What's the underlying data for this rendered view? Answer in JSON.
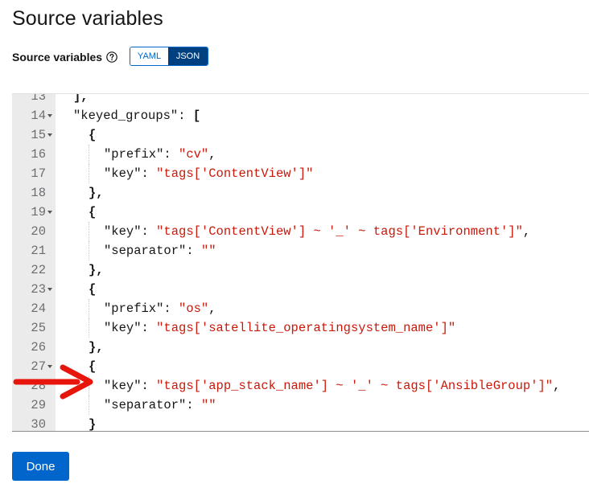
{
  "page": {
    "title": "Source variables"
  },
  "field": {
    "label": "Source variables",
    "help_icon": "question-circle-icon"
  },
  "toggle": {
    "yaml_label": "YAML",
    "json_label": "JSON",
    "selected": "JSON"
  },
  "editor": {
    "lines": [
      {
        "num": "13",
        "fold": false,
        "indent": 0,
        "parts": [
          {
            "t": "],",
            "c": "p"
          }
        ]
      },
      {
        "num": "14",
        "fold": true,
        "indent": 0,
        "parts": [
          {
            "t": "\"keyed_groups\"",
            "c": "k"
          },
          {
            "t": ": ",
            "c": "k"
          },
          {
            "t": "[",
            "c": "p"
          }
        ]
      },
      {
        "num": "15",
        "fold": true,
        "indent": 1,
        "parts": [
          {
            "t": "{",
            "c": "p"
          }
        ]
      },
      {
        "num": "16",
        "fold": false,
        "indent": 2,
        "parts": [
          {
            "t": "\"prefix\"",
            "c": "k"
          },
          {
            "t": ": ",
            "c": "k"
          },
          {
            "t": "\"cv\"",
            "c": "s"
          },
          {
            "t": ",",
            "c": "k"
          }
        ]
      },
      {
        "num": "17",
        "fold": false,
        "indent": 2,
        "parts": [
          {
            "t": "\"key\"",
            "c": "k"
          },
          {
            "t": ": ",
            "c": "k"
          },
          {
            "t": "\"tags['ContentView']\"",
            "c": "s"
          }
        ]
      },
      {
        "num": "18",
        "fold": false,
        "indent": 1,
        "parts": [
          {
            "t": "},",
            "c": "p"
          }
        ]
      },
      {
        "num": "19",
        "fold": true,
        "indent": 1,
        "parts": [
          {
            "t": "{",
            "c": "p"
          }
        ]
      },
      {
        "num": "20",
        "fold": false,
        "indent": 2,
        "parts": [
          {
            "t": "\"key\"",
            "c": "k"
          },
          {
            "t": ": ",
            "c": "k"
          },
          {
            "t": "\"tags['ContentView'] ~ '_' ~ tags['Environment']\"",
            "c": "s"
          },
          {
            "t": ",",
            "c": "k"
          }
        ]
      },
      {
        "num": "21",
        "fold": false,
        "indent": 2,
        "parts": [
          {
            "t": "\"separator\"",
            "c": "k"
          },
          {
            "t": ": ",
            "c": "k"
          },
          {
            "t": "\"\"",
            "c": "s"
          }
        ]
      },
      {
        "num": "22",
        "fold": false,
        "indent": 1,
        "parts": [
          {
            "t": "},",
            "c": "p"
          }
        ]
      },
      {
        "num": "23",
        "fold": true,
        "indent": 1,
        "parts": [
          {
            "t": "{",
            "c": "p"
          }
        ]
      },
      {
        "num": "24",
        "fold": false,
        "indent": 2,
        "parts": [
          {
            "t": "\"prefix\"",
            "c": "k"
          },
          {
            "t": ": ",
            "c": "k"
          },
          {
            "t": "\"os\"",
            "c": "s"
          },
          {
            "t": ",",
            "c": "k"
          }
        ]
      },
      {
        "num": "25",
        "fold": false,
        "indent": 2,
        "parts": [
          {
            "t": "\"key\"",
            "c": "k"
          },
          {
            "t": ": ",
            "c": "k"
          },
          {
            "t": "\"tags['satellite_operatingsystem_name']\"",
            "c": "s"
          }
        ]
      },
      {
        "num": "26",
        "fold": false,
        "indent": 1,
        "parts": [
          {
            "t": "},",
            "c": "p"
          }
        ]
      },
      {
        "num": "27",
        "fold": true,
        "indent": 1,
        "parts": [
          {
            "t": "{",
            "c": "p"
          }
        ]
      },
      {
        "num": "28",
        "fold": false,
        "indent": 2,
        "parts": [
          {
            "t": "\"key\"",
            "c": "k"
          },
          {
            "t": ": ",
            "c": "k"
          },
          {
            "t": "\"tags['app_stack_name'] ~ '_' ~ tags['AnsibleGroup']\"",
            "c": "s"
          },
          {
            "t": ",",
            "c": "k"
          }
        ]
      },
      {
        "num": "29",
        "fold": false,
        "indent": 2,
        "parts": [
          {
            "t": "\"separator\"",
            "c": "k"
          },
          {
            "t": ": ",
            "c": "k"
          },
          {
            "t": "\"\"",
            "c": "s"
          }
        ]
      },
      {
        "num": "30",
        "fold": false,
        "indent": 1,
        "parts": [
          {
            "t": "}",
            "c": "p"
          }
        ]
      }
    ]
  },
  "annotation": {
    "arrow_color": "#e8150c",
    "arrow_icon": "red-arrow-pointing-right-icon"
  },
  "actions": {
    "done_label": "Done"
  },
  "colors": {
    "primary": "#0066cc",
    "selected_toggle": "#004080",
    "string": "#c9190b"
  }
}
